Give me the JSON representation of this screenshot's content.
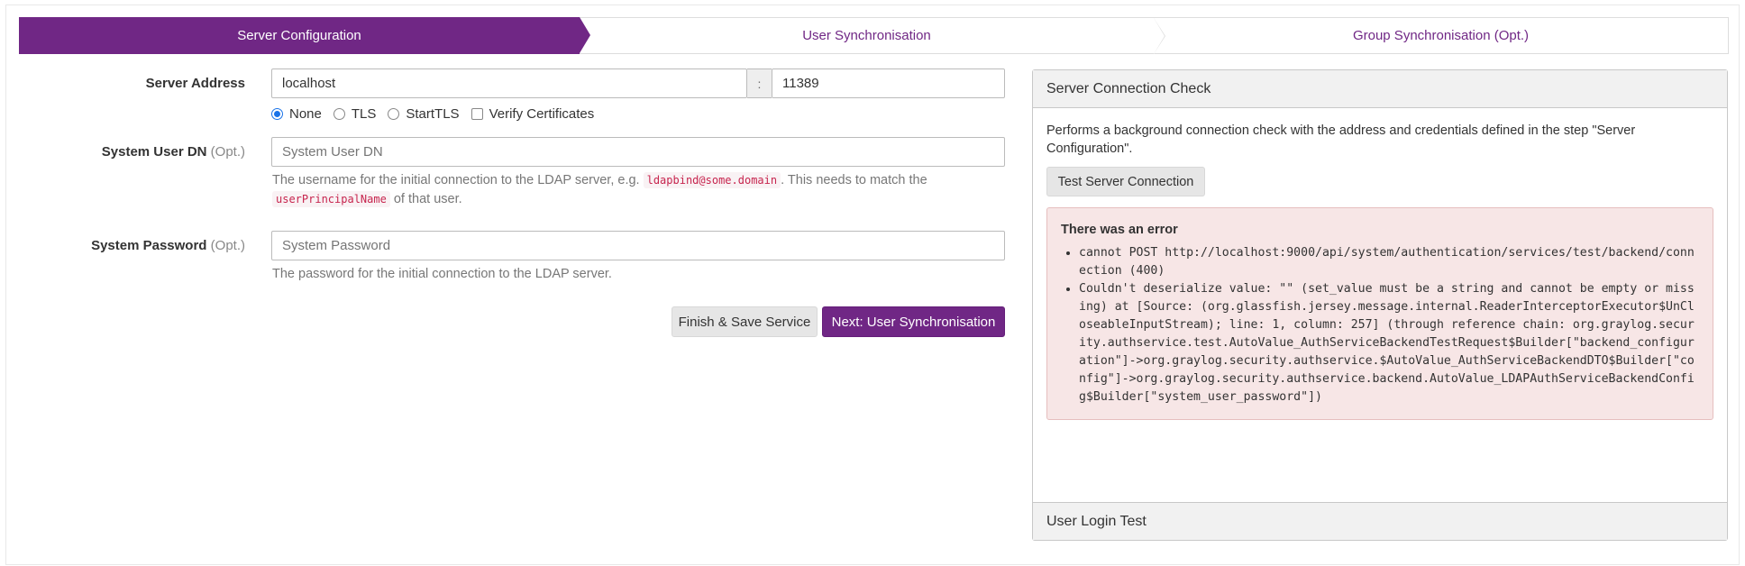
{
  "stepper": {
    "steps": [
      {
        "label": "Server Configuration"
      },
      {
        "label": "User Synchronisation"
      },
      {
        "label": "Group Synchronisation (Opt.)"
      }
    ]
  },
  "form": {
    "server_address": {
      "label": "Server Address",
      "host_value": "localhost",
      "separator": ":",
      "port_value": "11389"
    },
    "transport": {
      "options": [
        "None",
        "TLS",
        "StartTLS"
      ],
      "selected": "None",
      "verify_label": "Verify Certificates"
    },
    "system_user_dn": {
      "label": "System User DN",
      "opt": "(Opt.)",
      "placeholder": "System User DN",
      "help_prefix": "The username for the initial connection to the LDAP server, e.g. ",
      "help_code1": "ldapbind@some.domain",
      "help_middle": ". This needs to match the",
      "help_code2": "userPrincipalName",
      "help_suffix": " of that user."
    },
    "system_password": {
      "label": "System Password",
      "opt": "(Opt.)",
      "placeholder": "System Password",
      "help": "The password for the initial connection to the LDAP server."
    },
    "buttons": {
      "finish_label": "Finish & Save Service",
      "next_label": "Next: User Synchronisation"
    }
  },
  "connection_check": {
    "title": "Server Connection Check",
    "description": "Performs a background connection check with the address and credentials defined in the step \"Server Configuration\".",
    "test_button": "Test Server Connection",
    "error": {
      "title": "There was an error",
      "items": [
        "cannot POST http://localhost:9000/api/system/authentication/services/test/backend/connection (400)",
        "Couldn't deserialize value: \"\" (set_value must be a string and cannot be empty or missing) at [Source: (org.glassfish.jersey.message.internal.ReaderInterceptorExecutor$UnCloseableInputStream); line: 1, column: 257] (through reference chain: org.graylog.security.authservice.test.AutoValue_AuthServiceBackendTestRequest$Builder[\"backend_configuration\"]->org.graylog.security.authservice.$AutoValue_AuthServiceBackendDTO$Builder[\"config\"]->org.graylog.security.authservice.backend.AutoValue_LDAPAuthServiceBackendConfig$Builder[\"system_user_password\"])"
      ]
    }
  },
  "login_test": {
    "title": "User Login Test"
  },
  "colors": {
    "accent": "#702785",
    "error_bg": "#f7e6e6"
  }
}
